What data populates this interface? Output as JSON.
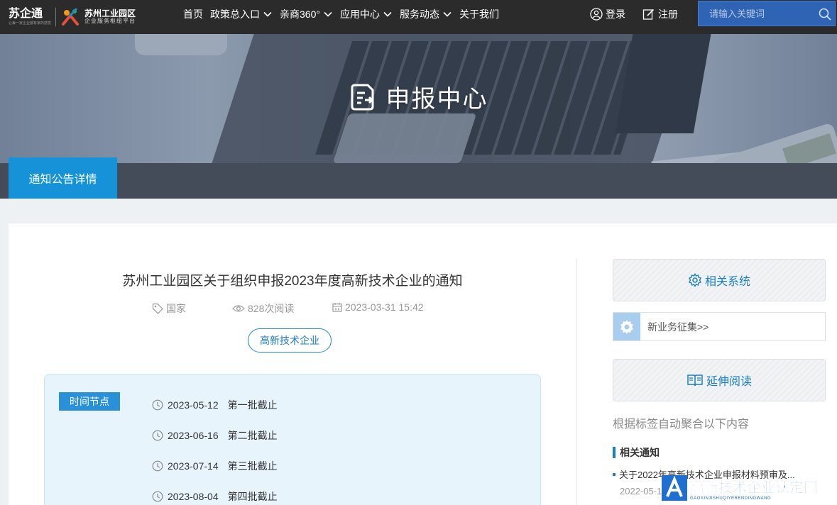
{
  "header": {
    "logo_main": "苏企通",
    "logo_tagline": "让每一家企业都有家的感觉",
    "logo_sub_title": "苏州工业园区",
    "logo_sub_caption": "企业服务枢纽平台",
    "nav": [
      {
        "label": "首页",
        "has_dropdown": false
      },
      {
        "label": "政策总入口",
        "has_dropdown": true
      },
      {
        "label": "亲商360°",
        "has_dropdown": true
      },
      {
        "label": "应用中心",
        "has_dropdown": true
      },
      {
        "label": "服务动态",
        "has_dropdown": true
      },
      {
        "label": "关于我们",
        "has_dropdown": false
      }
    ],
    "login_label": "登录",
    "register_label": "注册",
    "search_placeholder": "请输入关键词"
  },
  "banner": {
    "title": "申报中心"
  },
  "subnav": {
    "active_tab": "通知公告详情"
  },
  "article": {
    "title": "苏州工业园区关于组织申报2023年度高新技术企业的通知",
    "meta": {
      "level": "国家",
      "views": "828次阅读",
      "datetime": "2023-03-31 15:42"
    },
    "tag": "高新技术企业",
    "timeline_label": "时间节点",
    "timeline": [
      {
        "date": "2023-05-12",
        "text": "第一批截止"
      },
      {
        "date": "2023-06-16",
        "text": "第二批截止"
      },
      {
        "date": "2023-07-14",
        "text": "第三批截止"
      },
      {
        "date": "2023-08-04",
        "text": "第四批截止"
      }
    ]
  },
  "sidebar": {
    "related_systems_title": "相关系统",
    "system_link": "新业务征集>>",
    "extended_reading_title": "延伸阅读",
    "note": "根据标签自动聚合以下内容",
    "related_notices_title": "相关通知",
    "notices": [
      {
        "title": "关于2022年高新技术企业申报材料预审及...",
        "date": "2022-05-1"
      }
    ]
  },
  "watermark": {
    "text": "高新技术企业认定网",
    "pinyin": "GAOXINJISHUQIYERENDINGWANG"
  },
  "colors": {
    "topbar": "#2b2b2b",
    "accent": "#1592d8",
    "link_blue": "#1a7fc4",
    "subbar": "#454c59",
    "timeline_bg": "#e8f4fc"
  }
}
